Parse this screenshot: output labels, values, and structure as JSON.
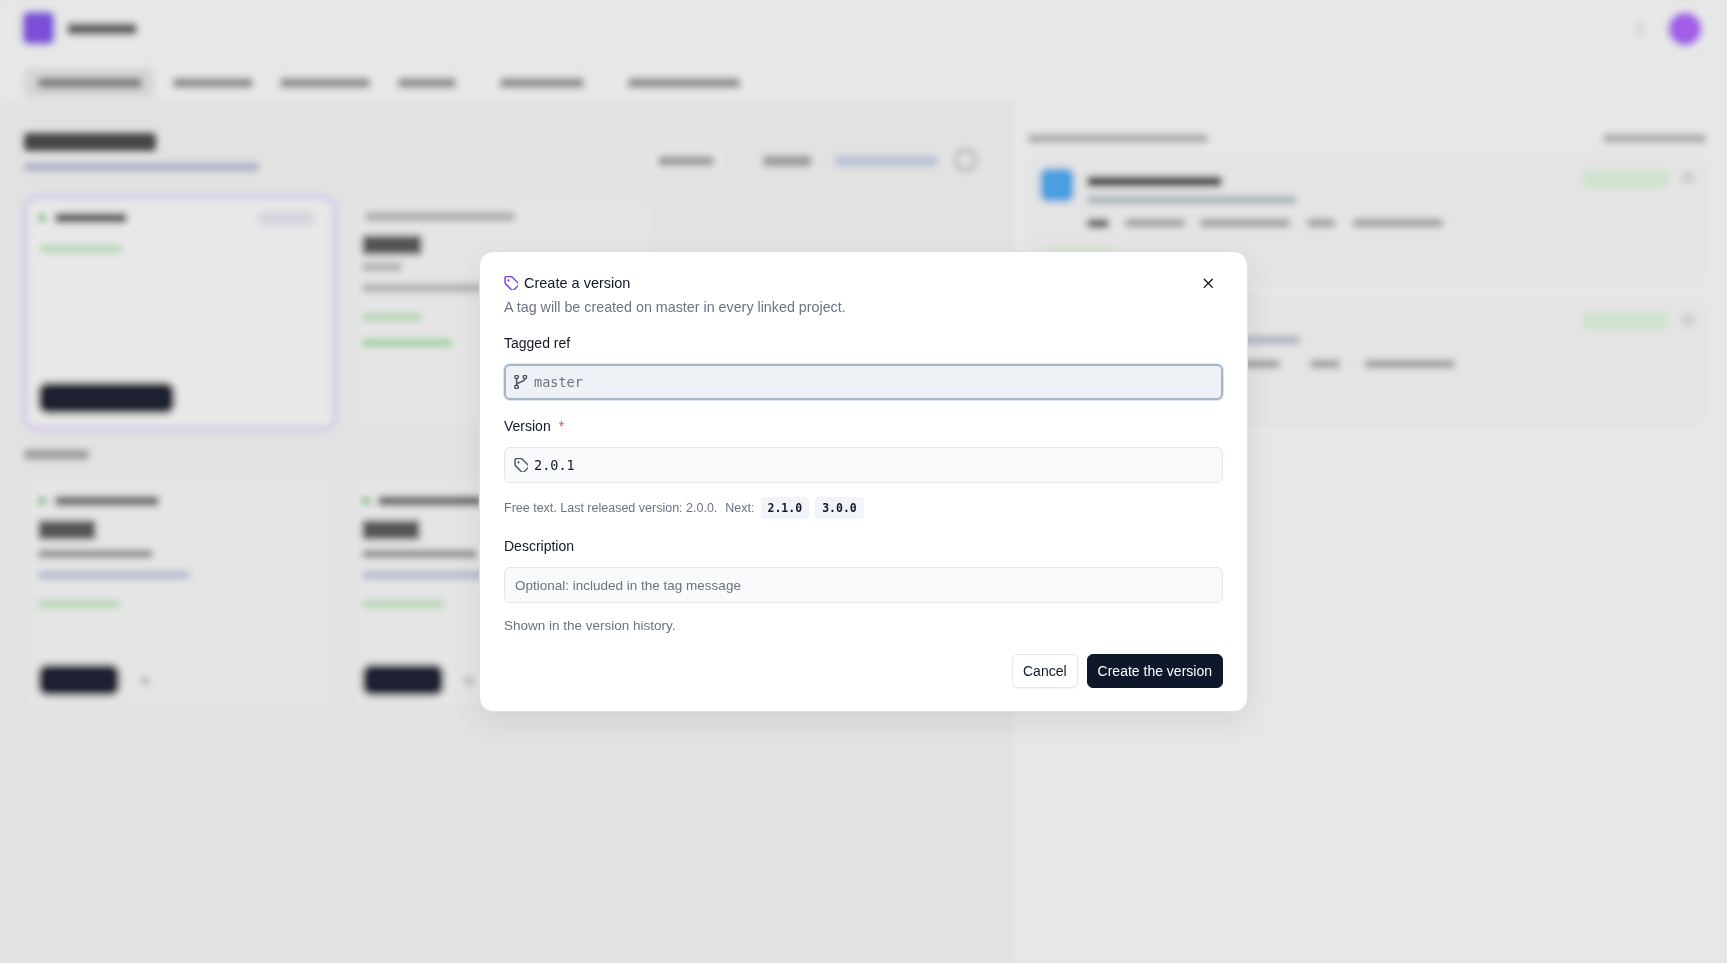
{
  "dialog": {
    "title": "Create a version",
    "subtitle": "A tag will be created on master in every linked project.",
    "fields": [
      {
        "kind": "ref",
        "label": "Tagged ref",
        "value": "master",
        "focused": true
      },
      {
        "kind": "version",
        "label": "Version",
        "required_mark": "*",
        "value": "2.0.1",
        "focused": false,
        "hint": "Free text. Last released version: 2.0.0.",
        "next_label": "Next:",
        "suggestions": [
          "2.1.0",
          "3.0.0"
        ]
      },
      {
        "kind": "text",
        "label": "Description",
        "placeholder": "Optional: included in the tag message",
        "focused": false,
        "help": "Shown in the version history."
      }
    ],
    "buttons": [
      {
        "label": "Cancel",
        "kind": "secondary"
      },
      {
        "label": "Create the version",
        "kind": "primary"
      }
    ]
  }
}
